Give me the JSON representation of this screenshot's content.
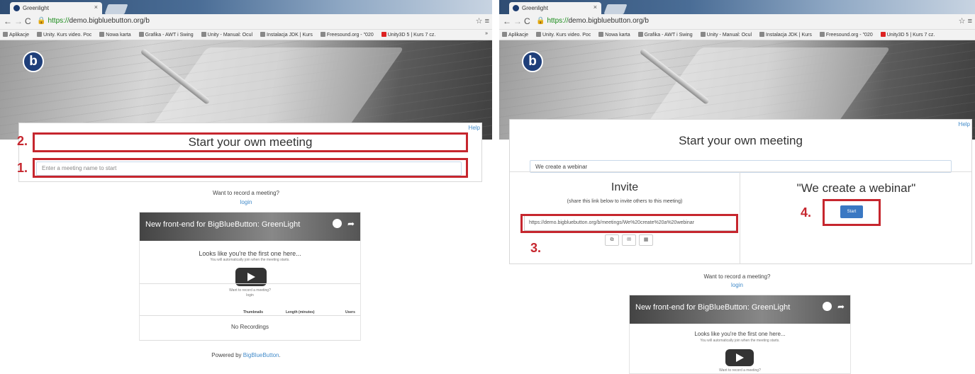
{
  "browser": {
    "tab_title": "Greenlight",
    "tab_close": "×",
    "url_https": "https://",
    "url_rest": "demo.bigbluebutton.org/b",
    "bookmarks": [
      "Aplikacje",
      "Unity. Kurs video. Poc",
      "Nowa karta",
      "Grafika - AWT i Swing",
      "Unity - Manual: Ocul",
      "Instalacja JDK | Kurs",
      "Freesound.org - \"020",
      "Unity3D 5 | Kurs 7 cz."
    ],
    "bookmarks_more": "»"
  },
  "left": {
    "help": "Help",
    "title": "Start your own meeting",
    "input_placeholder": "Enter a meeting name to start",
    "annotation_1": "1.",
    "annotation_2": "2.",
    "record_question": "Want to record a meeting?",
    "login": "login",
    "video_title": "New front-end for BigBlueButton: GreenLight",
    "first_one": "Looks like you're the first one here...",
    "auto_join": "You will automatically join when the meeting starts.",
    "small_record": "Want to record a meeting?",
    "small_login": "login",
    "col_thumbnails": "Thumbnails",
    "col_length": "Length (minutes)",
    "col_users": "Users",
    "no_recordings": "No Recordings",
    "powered_prefix": "Powered by ",
    "powered_link": "BigBlueButton",
    "powered_suffix": "."
  },
  "right": {
    "help": "Help",
    "title": "Start your own meeting",
    "input_value": "We create a webinar",
    "invite_title": "Invite",
    "invite_sub": "(share this link below to invite others to this meeting)",
    "invite_link": "https://demo.bigbluebutton.org/b/meetings/We%20create%20a%20webinar",
    "meeting_name": "\"We create a webinar\"",
    "start": "Start",
    "annotation_3": "3.",
    "annotation_4": "4.",
    "record_question": "Want to record a meeting?",
    "login": "login",
    "video_title": "New front-end for BigBlueButton: GreenLight",
    "first_one": "Looks like you're the first one here...",
    "auto_join": "You will automatically join when the meeting starts.",
    "small_record": "Want to record a meeting?"
  },
  "colors": {
    "annotation_red": "#c6262e",
    "link_blue": "#428bca",
    "start_blue": "#3a78c3"
  },
  "icons": [
    "back-icon",
    "forward-icon",
    "reload-icon",
    "lock-icon",
    "star-icon",
    "menu-icon",
    "play-icon",
    "clock-icon",
    "share-icon",
    "copy-icon",
    "email-icon",
    "qr-icon"
  ]
}
